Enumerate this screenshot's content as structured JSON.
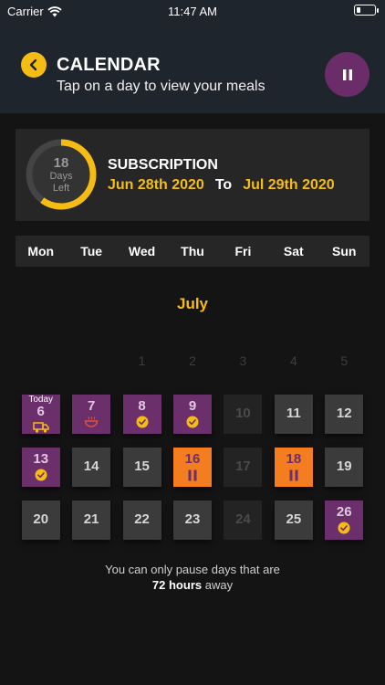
{
  "status": {
    "carrier": "Carrier",
    "time": "11:47 AM"
  },
  "header": {
    "title": "CALENDAR",
    "subtitle": "Tap on a day to view your meals"
  },
  "subscription": {
    "days_left": "18",
    "days_label": "Days",
    "left_label": "Left",
    "days_left_fraction": 0.6,
    "title": "SUBSCRIPTION",
    "start": "Jun 28th 2020",
    "to": "To",
    "end": "Jul 29th 2020"
  },
  "weekdays": [
    "Mon",
    "Tue",
    "Wed",
    "Thu",
    "Fri",
    "Sat",
    "Sun"
  ],
  "month": "July",
  "empty_row": [
    "",
    "",
    "1",
    "2",
    "3",
    "4",
    "5"
  ],
  "days": [
    {
      "n": "6",
      "style": "purple",
      "today": "Today",
      "icon": "truck-icon"
    },
    {
      "n": "7",
      "style": "purple",
      "icon": "bowl-icon"
    },
    {
      "n": "8",
      "style": "purple",
      "icon": "check-icon"
    },
    {
      "n": "9",
      "style": "purple",
      "icon": "check-icon"
    },
    {
      "n": "10",
      "style": "disabled"
    },
    {
      "n": "11",
      "style": "normal"
    },
    {
      "n": "12",
      "style": "normal"
    },
    {
      "n": "13",
      "style": "purple",
      "icon": "check-icon"
    },
    {
      "n": "14",
      "style": "normal"
    },
    {
      "n": "15",
      "style": "normal"
    },
    {
      "n": "16",
      "style": "orange",
      "icon": "pause-icon"
    },
    {
      "n": "17",
      "style": "disabled"
    },
    {
      "n": "18",
      "style": "orange",
      "icon": "pause-icon"
    },
    {
      "n": "19",
      "style": "normal"
    },
    {
      "n": "20",
      "style": "normal"
    },
    {
      "n": "21",
      "style": "normal"
    },
    {
      "n": "22",
      "style": "normal"
    },
    {
      "n": "23",
      "style": "normal"
    },
    {
      "n": "24",
      "style": "disabled"
    },
    {
      "n": "25",
      "style": "normal"
    },
    {
      "n": "26",
      "style": "purple",
      "icon": "check-icon"
    }
  ],
  "note": {
    "line1": "You can only pause days that are",
    "bold": "72 hours",
    "after": " away"
  },
  "colors": {
    "accent": "#f5bd14",
    "purple": "#6b2f6b",
    "orange": "#f47d20",
    "header": "#1f252c"
  }
}
